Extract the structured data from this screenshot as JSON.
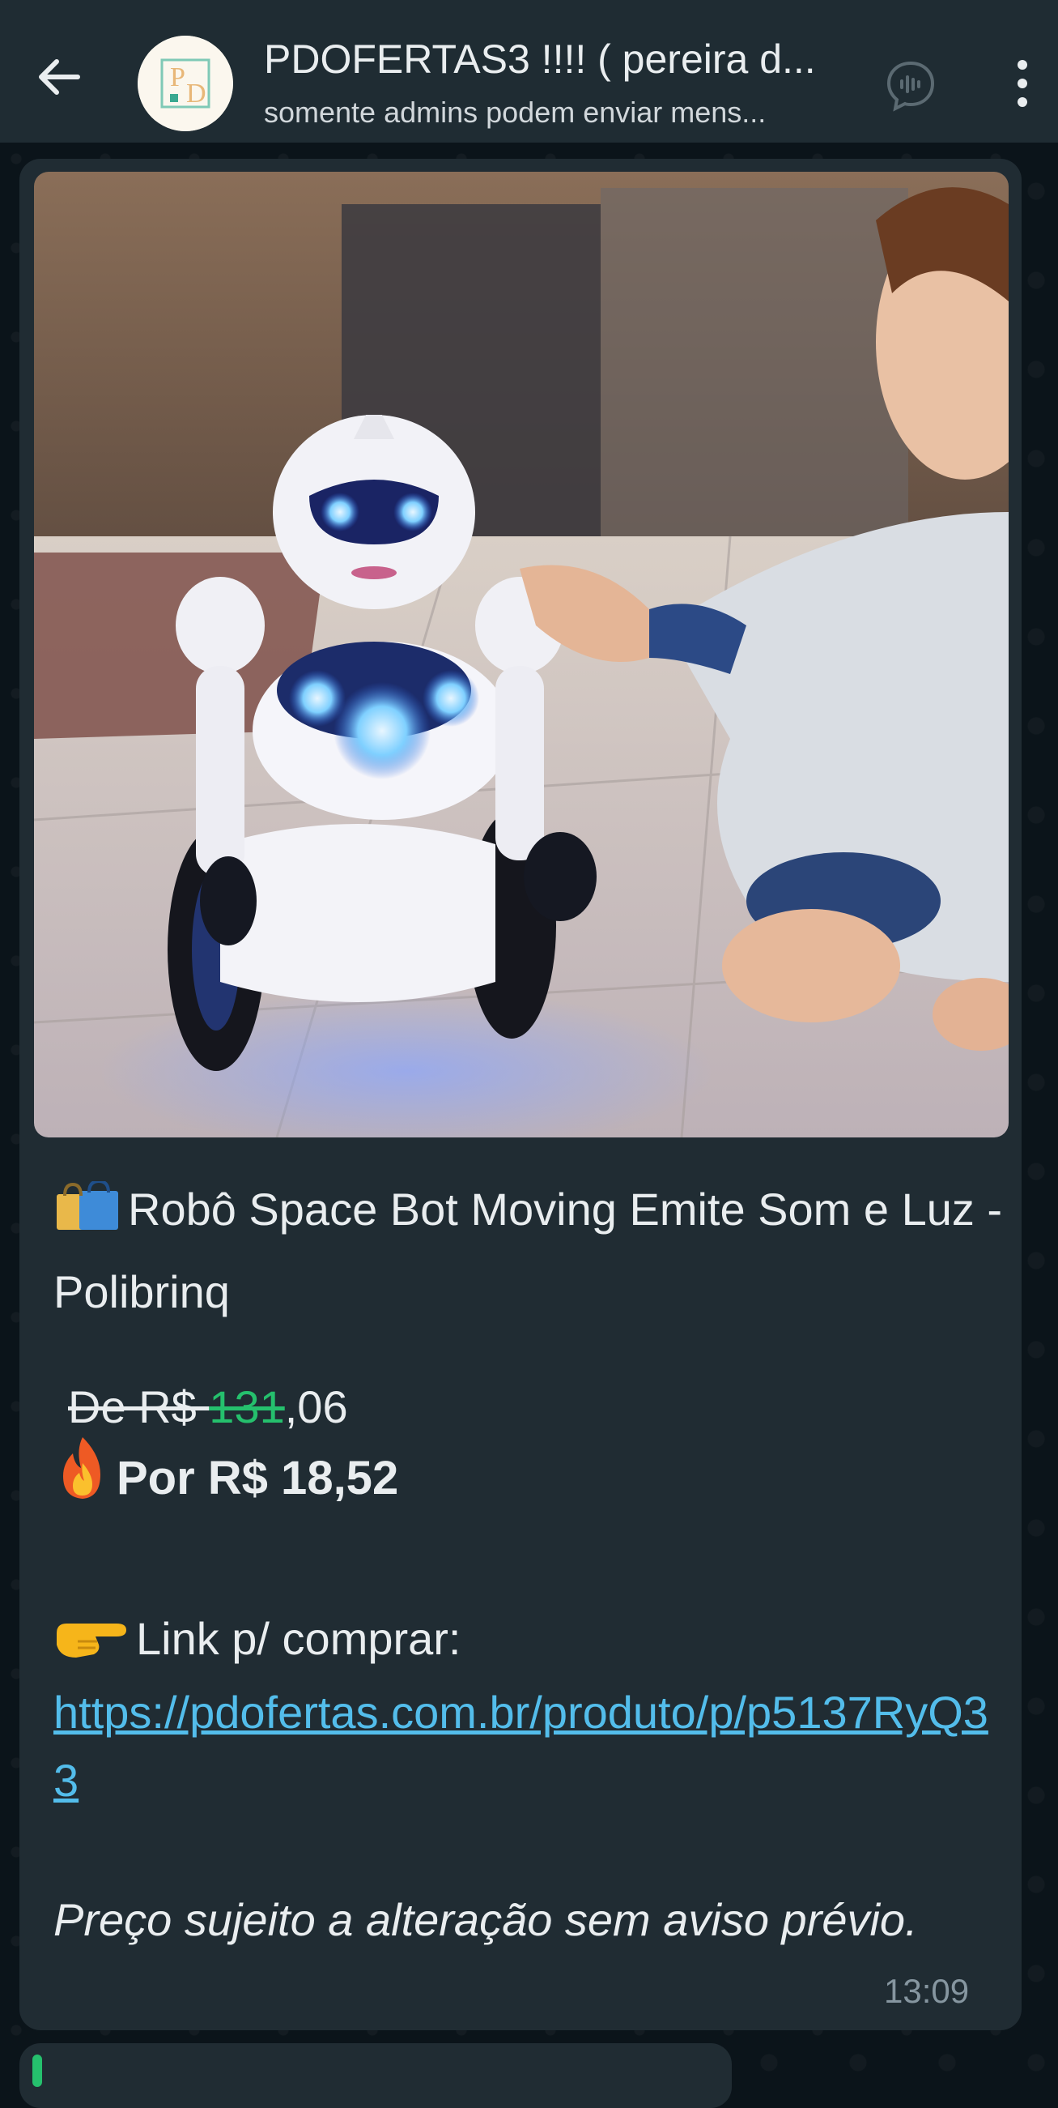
{
  "header": {
    "title": "PDOFERTAS3 !!!! ( pereira d...",
    "subtitle": "somente admins podem enviar mens...",
    "avatar_text": "PD"
  },
  "message": {
    "title": "Robô Space Bot Moving Emite Som e Luz - Polibrinq",
    "title_icon": "shopping-bags-emoji",
    "old_price_prefix": "De R$ ",
    "old_price_green": "131",
    "old_price_suffix": ",06",
    "new_price_icon": "fire-emoji",
    "new_price": "Por R$ 18,52",
    "link_icon": "pointing-hand-emoji",
    "link_label": "Link p/ comprar:",
    "link_url": "https://pdofertas.com.br/produto/p/p5137RyQ33",
    "disclaimer": "Preço sujeito a alteração sem aviso prévio.",
    "time": "13:09"
  },
  "colors": {
    "header_bg": "#1f2c33",
    "chat_bg": "#0b141a",
    "bubble_bg": "#202c33",
    "link": "#53bdeb",
    "accent_green": "#25c06d",
    "text": "#e9edef",
    "meta": "#8696a0"
  }
}
